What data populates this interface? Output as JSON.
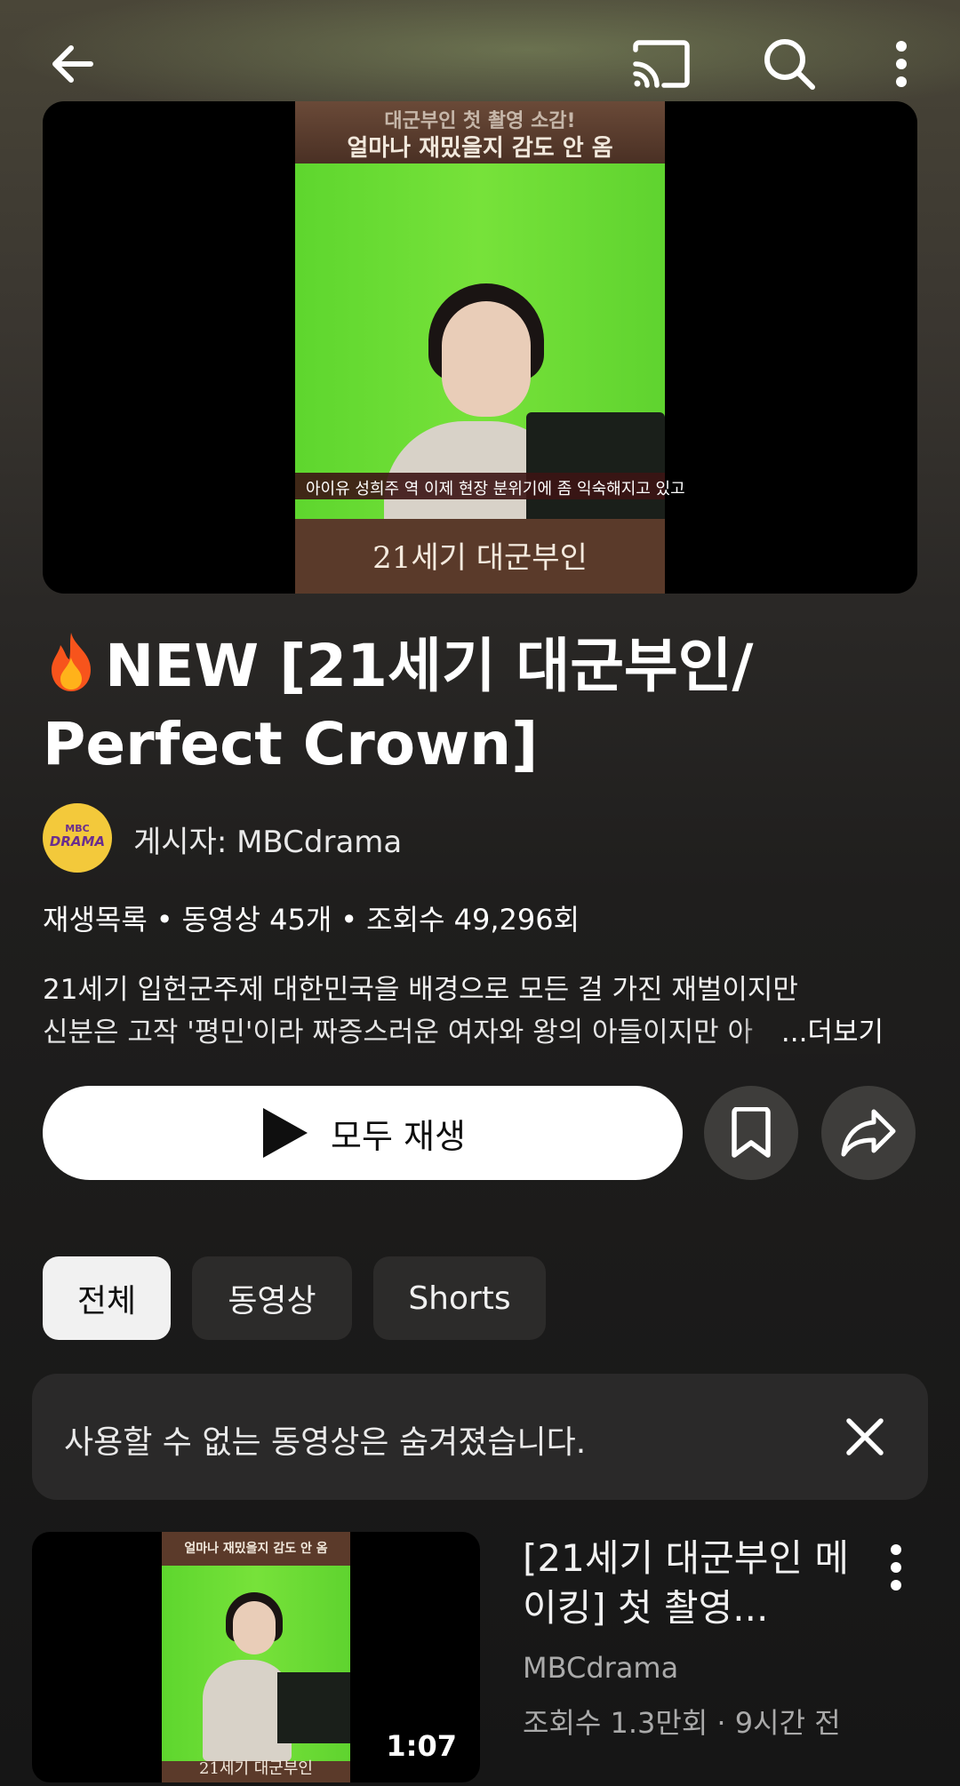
{
  "topbar": {
    "icons": [
      "back-arrow-icon",
      "cast-icon",
      "search-icon",
      "more-vert-icon"
    ]
  },
  "hero": {
    "poster_top_line1": "대군부인 첫 촬영 소감!",
    "poster_top_line2": "얼마나 재밌을지 감도 안 옴",
    "lower_third": "아이유  성희주 역    이제 현장 분위기에 좀 익숙해지고 있고",
    "poster_bottom": "21세기 대군부인"
  },
  "playlist": {
    "title": "NEW [21세기 대군부인/ Perfect Crown]",
    "avatar_top": "MBC",
    "avatar_bottom": "DRAMA",
    "poster": "게시자: MBCdrama",
    "type": "재생목록",
    "video_count": "동영상 45개",
    "views": "조회수 49,296회",
    "desc_line1": "21세기 입헌군주제 대한민국을 배경으로 모든 걸 가진 재벌이지만",
    "desc_line2": "신분은 고작 '평민'이라 짜증스러운 여자와 왕의 아들이지만 아",
    "more": "...더보기"
  },
  "actions": {
    "play_all": "모두 재생"
  },
  "filters": [
    "전체",
    "동영상",
    "Shorts"
  ],
  "notice": {
    "text": "사용할 수 없는 동영상은 숨겨졌습니다."
  },
  "videos": [
    {
      "title": "[21세기 대군부인 메이킹] 첫 촬영...",
      "channel": "MBCdrama",
      "stats": "조회수 1.3만회 · 9시간 전",
      "duration": "1:07",
      "thumb_top": "얼마나 재밌을지 감도 안 옴",
      "thumb_bottom": "21세기 대군부인"
    }
  ],
  "colors": {
    "accent_white": "#ffffff",
    "chip_active": "#f1f1f1",
    "chip_inactive": "#2c2b2a",
    "secondary_text": "#aaaaaa"
  }
}
